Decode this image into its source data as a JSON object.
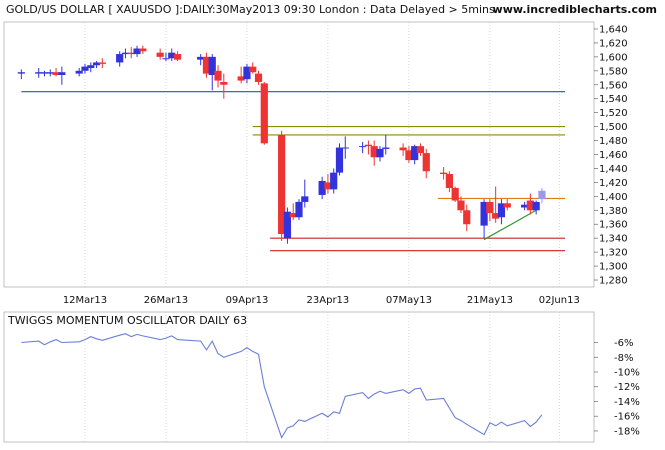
{
  "header": {
    "title": "GOLD/US DOLLAR [ XAUUSDO ]:DAILY:30May2013 09:30 London : Data Delayed > 5mins",
    "site": "www.incrediblecharts.com"
  },
  "oscillator": {
    "title": "TWIGGS MOMENTUM OSCILLATOR DAILY 63"
  },
  "colors": {
    "up": "#3333dd",
    "down": "#ee3333",
    "last_candle": "#9999ee",
    "support_blue": "#1a5e9c",
    "resistance_olive": "#8b8b00",
    "resistance_orange": "#e07b1a",
    "support_red": "#cc2222",
    "trendline": "#2e9a2e",
    "oscillator_line": "#6b7fd7",
    "grid": "#c8c8c8"
  },
  "chart_data": [
    {
      "type": "candlestick",
      "title": "GOLD/US DOLLAR [ XAUUSDO ]:DAILY:30May2013 09:30 London : Data Delayed > 5mins",
      "ylim": [
        1270,
        1650
      ],
      "y_ticks": [
        1280,
        1300,
        1320,
        1340,
        1360,
        1380,
        1400,
        1420,
        1440,
        1460,
        1480,
        1500,
        1520,
        1540,
        1560,
        1580,
        1600,
        1620,
        1640
      ],
      "x_ticks": [
        {
          "label": "12Mar13",
          "date": "2013-03-12"
        },
        {
          "label": "26Mar13",
          "date": "2013-03-26"
        },
        {
          "label": "09Apr13",
          "date": "2013-04-09"
        },
        {
          "label": "23Apr13",
          "date": "2013-04-23"
        },
        {
          "label": "07May13",
          "date": "2013-05-07"
        },
        {
          "label": "21May13",
          "date": "2013-05-21"
        },
        {
          "label": "02Jun13",
          "date": "2013-06-02"
        }
      ],
      "grid": "vertical",
      "candles": [
        {
          "date": "2013-03-01",
          "open": 1576,
          "high": 1582,
          "low": 1568,
          "close": 1578
        },
        {
          "date": "2013-03-04",
          "open": 1576,
          "high": 1584,
          "low": 1570,
          "close": 1578
        },
        {
          "date": "2013-03-05",
          "open": 1576,
          "high": 1580,
          "low": 1572,
          "close": 1578
        },
        {
          "date": "2013-03-06",
          "open": 1576,
          "high": 1582,
          "low": 1572,
          "close": 1578
        },
        {
          "date": "2013-03-07",
          "open": 1578,
          "high": 1584,
          "low": 1572,
          "close": 1574
        },
        {
          "date": "2013-03-08",
          "open": 1574,
          "high": 1586,
          "low": 1560,
          "close": 1578
        },
        {
          "date": "2013-03-11",
          "open": 1576,
          "high": 1584,
          "low": 1572,
          "close": 1580
        },
        {
          "date": "2013-03-12",
          "open": 1580,
          "high": 1590,
          "low": 1576,
          "close": 1586
        },
        {
          "date": "2013-03-13",
          "open": 1584,
          "high": 1592,
          "low": 1578,
          "close": 1588
        },
        {
          "date": "2013-03-14",
          "open": 1588,
          "high": 1594,
          "low": 1584,
          "close": 1592
        },
        {
          "date": "2013-03-15",
          "open": 1592,
          "high": 1598,
          "low": 1584,
          "close": 1590
        },
        {
          "date": "2013-03-18",
          "open": 1592,
          "high": 1608,
          "low": 1586,
          "close": 1604
        },
        {
          "date": "2013-03-19",
          "open": 1604,
          "high": 1612,
          "low": 1598,
          "close": 1606
        },
        {
          "date": "2013-03-20",
          "open": 1606,
          "high": 1614,
          "low": 1598,
          "close": 1604
        },
        {
          "date": "2013-03-21",
          "open": 1604,
          "high": 1616,
          "low": 1600,
          "close": 1612
        },
        {
          "date": "2013-03-22",
          "open": 1612,
          "high": 1616,
          "low": 1604,
          "close": 1608
        },
        {
          "date": "2013-03-25",
          "open": 1606,
          "high": 1612,
          "low": 1596,
          "close": 1600
        },
        {
          "date": "2013-03-26",
          "open": 1598,
          "high": 1606,
          "low": 1594,
          "close": 1598
        },
        {
          "date": "2013-03-27",
          "open": 1598,
          "high": 1612,
          "low": 1594,
          "close": 1606
        },
        {
          "date": "2013-03-28",
          "open": 1604,
          "high": 1608,
          "low": 1594,
          "close": 1596
        },
        {
          "date": "2013-04-01",
          "open": 1596,
          "high": 1604,
          "low": 1588,
          "close": 1600
        },
        {
          "date": "2013-04-02",
          "open": 1600,
          "high": 1606,
          "low": 1570,
          "close": 1576
        },
        {
          "date": "2013-04-03",
          "open": 1574,
          "high": 1604,
          "low": 1552,
          "close": 1600
        },
        {
          "date": "2013-04-04",
          "open": 1580,
          "high": 1588,
          "low": 1556,
          "close": 1566
        },
        {
          "date": "2013-04-05",
          "open": 1564,
          "high": 1576,
          "low": 1540,
          "close": 1560
        },
        {
          "date": "2013-04-08",
          "open": 1572,
          "high": 1586,
          "low": 1562,
          "close": 1566
        },
        {
          "date": "2013-04-09",
          "open": 1568,
          "high": 1590,
          "low": 1562,
          "close": 1586
        },
        {
          "date": "2013-04-10",
          "open": 1586,
          "high": 1592,
          "low": 1576,
          "close": 1578
        },
        {
          "date": "2013-04-11",
          "open": 1576,
          "high": 1580,
          "low": 1560,
          "close": 1564
        },
        {
          "date": "2013-04-12",
          "open": 1562,
          "high": 1564,
          "low": 1474,
          "close": 1476
        },
        {
          "date": "2013-04-15",
          "open": 1488,
          "high": 1494,
          "low": 1336,
          "close": 1346
        },
        {
          "date": "2013-04-16",
          "open": 1340,
          "high": 1384,
          "low": 1332,
          "close": 1378
        },
        {
          "date": "2013-04-17",
          "open": 1376,
          "high": 1390,
          "low": 1366,
          "close": 1370
        },
        {
          "date": "2013-04-18",
          "open": 1370,
          "high": 1396,
          "low": 1366,
          "close": 1392
        },
        {
          "date": "2013-04-19",
          "open": 1392,
          "high": 1424,
          "low": 1384,
          "close": 1400
        },
        {
          "date": "2013-04-22",
          "open": 1402,
          "high": 1428,
          "low": 1396,
          "close": 1422
        },
        {
          "date": "2013-04-23",
          "open": 1420,
          "high": 1432,
          "low": 1404,
          "close": 1410
        },
        {
          "date": "2013-04-24",
          "open": 1410,
          "high": 1440,
          "low": 1404,
          "close": 1434
        },
        {
          "date": "2013-04-25",
          "open": 1434,
          "high": 1476,
          "low": 1430,
          "close": 1470
        },
        {
          "date": "2013-04-26",
          "open": 1470,
          "high": 1486,
          "low": 1454,
          "close": 1470
        },
        {
          "date": "2013-04-29",
          "open": 1472,
          "high": 1478,
          "low": 1462,
          "close": 1472
        },
        {
          "date": "2013-04-30",
          "open": 1474,
          "high": 1480,
          "low": 1460,
          "close": 1472
        },
        {
          "date": "2013-05-01",
          "open": 1472,
          "high": 1480,
          "low": 1444,
          "close": 1456
        },
        {
          "date": "2013-05-02",
          "open": 1456,
          "high": 1472,
          "low": 1450,
          "close": 1468
        },
        {
          "date": "2013-05-03",
          "open": 1468,
          "high": 1488,
          "low": 1460,
          "close": 1470
        },
        {
          "date": "2013-05-06",
          "open": 1470,
          "high": 1476,
          "low": 1458,
          "close": 1466
        },
        {
          "date": "2013-05-07",
          "open": 1466,
          "high": 1472,
          "low": 1448,
          "close": 1452
        },
        {
          "date": "2013-05-08",
          "open": 1452,
          "high": 1474,
          "low": 1446,
          "close": 1472
        },
        {
          "date": "2013-05-09",
          "open": 1472,
          "high": 1476,
          "low": 1458,
          "close": 1462
        },
        {
          "date": "2013-05-10",
          "open": 1462,
          "high": 1468,
          "low": 1426,
          "close": 1436
        },
        {
          "date": "2013-05-13",
          "open": 1434,
          "high": 1442,
          "low": 1424,
          "close": 1432
        },
        {
          "date": "2013-05-14",
          "open": 1432,
          "high": 1436,
          "low": 1406,
          "close": 1412
        },
        {
          "date": "2013-05-15",
          "open": 1412,
          "high": 1414,
          "low": 1392,
          "close": 1394
        },
        {
          "date": "2013-05-16",
          "open": 1394,
          "high": 1400,
          "low": 1376,
          "close": 1380
        },
        {
          "date": "2013-05-17",
          "open": 1380,
          "high": 1388,
          "low": 1350,
          "close": 1360
        },
        {
          "date": "2013-05-20",
          "open": 1358,
          "high": 1396,
          "low": 1340,
          "close": 1392
        },
        {
          "date": "2013-05-21",
          "open": 1392,
          "high": 1396,
          "low": 1364,
          "close": 1376
        },
        {
          "date": "2013-05-22",
          "open": 1376,
          "high": 1414,
          "low": 1362,
          "close": 1368
        },
        {
          "date": "2013-05-23",
          "open": 1370,
          "high": 1396,
          "low": 1360,
          "close": 1390
        },
        {
          "date": "2013-05-24",
          "open": 1390,
          "high": 1396,
          "low": 1380,
          "close": 1384
        },
        {
          "date": "2013-05-27",
          "open": 1384,
          "high": 1392,
          "low": 1380,
          "close": 1388
        },
        {
          "date": "2013-05-28",
          "open": 1394,
          "high": 1404,
          "low": 1374,
          "close": 1380
        },
        {
          "date": "2013-05-29",
          "open": 1380,
          "high": 1394,
          "low": 1374,
          "close": 1392
        },
        {
          "date": "2013-05-30",
          "open": 1396,
          "high": 1412,
          "low": 1390,
          "close": 1408
        }
      ],
      "horizontal_lines": [
        {
          "value": 1550,
          "from": "2013-03-01",
          "to": "2013-06-03",
          "color": "#1a5e9c"
        },
        {
          "value": 1500,
          "from": "2013-04-10",
          "to": "2013-06-03",
          "color": "#8b8b00"
        },
        {
          "value": 1488,
          "from": "2013-04-10",
          "to": "2013-06-03",
          "color": "#8b8b00"
        },
        {
          "value": 1397,
          "from": "2013-05-12",
          "to": "2013-06-03",
          "color": "#e07b1a"
        },
        {
          "value": 1340,
          "from": "2013-04-13",
          "to": "2013-06-03",
          "color": "#cc2222"
        },
        {
          "value": 1322,
          "from": "2013-04-13",
          "to": "2013-06-03",
          "color": "#cc2222"
        }
      ],
      "trendlines": [
        {
          "from": {
            "date": "2013-05-20",
            "value": 1338
          },
          "to": {
            "date": "2013-05-29",
            "value": 1380
          },
          "color": "#2e9a2e"
        }
      ]
    },
    {
      "type": "line",
      "title": "TWIGGS MOMENTUM OSCILLATOR DAILY 63",
      "ylim": [
        -19.5,
        -4.3
      ],
      "y_ticks": [
        -6,
        -8,
        -10,
        -12,
        -14,
        -16,
        -18
      ],
      "y_tick_labels": [
        "-6%",
        "-8%",
        "-10%",
        "-12%",
        "-14%",
        "-16%",
        "-18%"
      ],
      "series": [
        {
          "x": [
            "2013-03-01",
            "2013-03-04",
            "2013-03-05",
            "2013-03-06",
            "2013-03-07",
            "2013-03-08",
            "2013-03-11",
            "2013-03-12",
            "2013-03-13",
            "2013-03-14",
            "2013-03-15",
            "2013-03-18",
            "2013-03-19",
            "2013-03-20",
            "2013-03-21",
            "2013-03-22",
            "2013-03-25",
            "2013-03-26",
            "2013-03-27",
            "2013-03-28",
            "2013-04-01",
            "2013-04-02",
            "2013-04-03",
            "2013-04-04",
            "2013-04-05",
            "2013-04-08",
            "2013-04-09",
            "2013-04-10",
            "2013-04-11",
            "2013-04-12",
            "2013-04-15",
            "2013-04-16",
            "2013-04-17",
            "2013-04-18",
            "2013-04-19",
            "2013-04-22",
            "2013-04-23",
            "2013-04-24",
            "2013-04-25",
            "2013-04-26",
            "2013-04-29",
            "2013-04-30",
            "2013-05-01",
            "2013-05-02",
            "2013-05-03",
            "2013-05-06",
            "2013-05-07",
            "2013-05-08",
            "2013-05-09",
            "2013-05-10",
            "2013-05-13",
            "2013-05-14",
            "2013-05-15",
            "2013-05-16",
            "2013-05-17",
            "2013-05-20",
            "2013-05-21",
            "2013-05-22",
            "2013-05-23",
            "2013-05-24",
            "2013-05-27",
            "2013-05-28",
            "2013-05-29",
            "2013-05-30"
          ],
          "values": [
            -6.0,
            -5.8,
            -6.3,
            -5.9,
            -5.6,
            -6.0,
            -5.9,
            -5.6,
            -5.2,
            -5.5,
            -5.7,
            -5.0,
            -4.8,
            -5.2,
            -4.9,
            -5.1,
            -5.6,
            -5.4,
            -5.1,
            -5.6,
            -5.8,
            -7.0,
            -5.8,
            -7.5,
            -8.0,
            -7.2,
            -6.7,
            -7.2,
            -7.6,
            -12.0,
            -18.9,
            -17.6,
            -17.3,
            -16.5,
            -16.7,
            -15.6,
            -16.1,
            -15.4,
            -15.6,
            -13.3,
            -12.8,
            -13.6,
            -13.0,
            -12.6,
            -12.9,
            -12.4,
            -12.9,
            -12.3,
            -12.2,
            -13.8,
            -13.6,
            -14.9,
            -16.2,
            -16.6,
            -17.1,
            -18.5,
            -16.9,
            -17.3,
            -16.8,
            -17.3,
            -16.6,
            -17.4,
            -16.8,
            -15.8
          ]
        }
      ]
    }
  ]
}
